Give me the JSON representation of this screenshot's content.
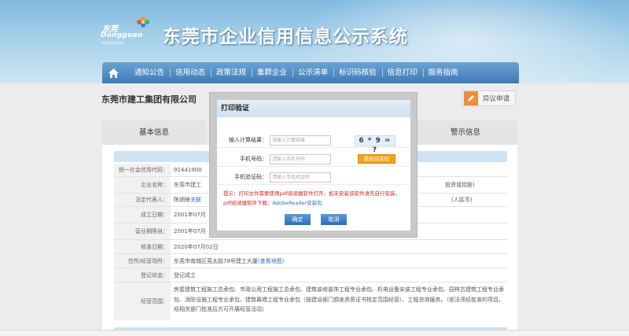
{
  "header": {
    "logo": {
      "cn": "东莞",
      "en": "Dongguan",
      "tagline": "每天都有新发现"
    },
    "site_title": "东莞市企业信用信息公示系统"
  },
  "nav": {
    "items": [
      "通知公告",
      "信用动态",
      "政策法规",
      "集群企业",
      "公示清单",
      "标识码核验",
      "信息打印",
      "服务指南"
    ]
  },
  "company": {
    "name": "东莞市建工集团有限公司",
    "objection_label": "异议申请"
  },
  "tabs": [
    "基本信息",
    "警示信息"
  ],
  "info_rows": [
    {
      "key": "统一社会信用代码：",
      "value": "91441900"
    },
    {
      "key": "企业名称：",
      "value": "东莞市建工",
      "tail": "投资或控股)"
    },
    {
      "key": "法定代表人：",
      "value": "陈炳锋",
      "link": "关联",
      "tail": "(人民币)"
    },
    {
      "key": "成立日期：",
      "value": "2001年07月"
    },
    {
      "key": "营业期限自：",
      "value": "2001年07月"
    },
    {
      "key": "核准日期：",
      "value": "2020年07月02日"
    },
    {
      "key": "住所/经营场所：",
      "value": "东莞市南城区莞太路78号建工大厦",
      "link": "(查看地图)"
    },
    {
      "key": "登记状态：",
      "value": "登记成立"
    },
    {
      "key": "经营范围：",
      "value": "房屋建筑工程施工总承包、市政公用工程施工总承包、建筑装修装饰工程专业承包、机电设备安装工程专业承包、园林古建筑工程专业承包、消防设施工程专业承包、建筑幕墙工程专业承包（按建设部门颁发资质证书核定范围经营）、工程咨询服务。（依法须经批准的项目，经相关部门批准后方可开展经营活动）"
    }
  ],
  "modal": {
    "title": "打印验证",
    "fields": [
      {
        "label": "输入计算结果：",
        "placeholder": "请输入计算结果"
      },
      {
        "label": "手机号码：",
        "placeholder": "请输入手机号码"
      },
      {
        "label": "手机验证码：",
        "placeholder": "请输入手机验证码"
      }
    ],
    "captcha": "6 * 9 = ?",
    "get_code_label": "获取验证码",
    "tip_text": "提示：打印文件需要使用pdf阅读器软件打开，如未安装该软件请先自行安装，pdf阅读器软件下载：",
    "tip_link": "AdobeReader安装包",
    "confirm_label": "确定",
    "cancel_label": "取消"
  },
  "colors": {
    "nav": "#3d7ab8",
    "accent": "#f3a314",
    "tip": "#d62222"
  }
}
